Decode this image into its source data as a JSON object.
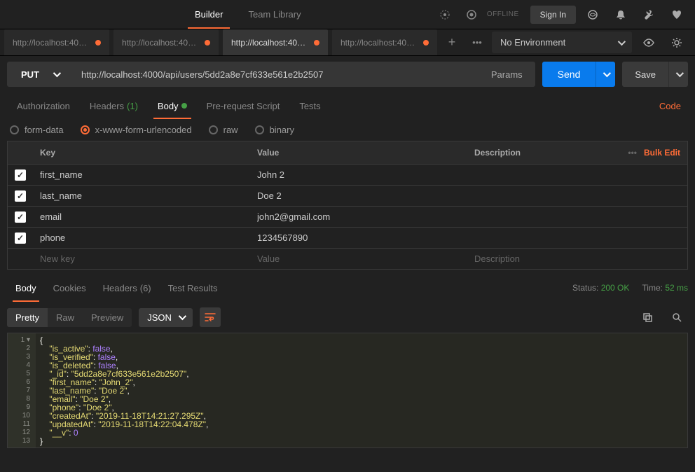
{
  "topbar": {
    "nav": {
      "builder": "Builder",
      "teamLibrary": "Team Library"
    },
    "offline": "OFFLINE",
    "signIn": "Sign In"
  },
  "reqTabs": [
    {
      "label": "http://localhost:4000...",
      "active": false
    },
    {
      "label": "http://localhost:4000...",
      "active": false
    },
    {
      "label": "http://localhost:4000...",
      "active": true
    },
    {
      "label": "http://localhost:4000...",
      "active": false
    }
  ],
  "addTabGlyph": "+",
  "env": {
    "selected": "No Environment"
  },
  "url": {
    "method": "PUT",
    "value": "http://localhost:4000/api/users/5dd2a8e7cf633e561e2b2507",
    "params": "Params",
    "send": "Send",
    "save": "Save"
  },
  "subtabs": {
    "authorization": "Authorization",
    "headers": "Headers",
    "headersCount": "(1)",
    "body": "Body",
    "prerequest": "Pre-request Script",
    "tests": "Tests",
    "code": "Code"
  },
  "bodytypes": {
    "formdata": "form-data",
    "urlencoded": "x-www-form-urlencoded",
    "raw": "raw",
    "binary": "binary"
  },
  "table": {
    "head": {
      "key": "Key",
      "value": "Value",
      "description": "Description",
      "bulkEdit": "Bulk Edit"
    },
    "rows": [
      {
        "key": "first_name",
        "value": "John 2",
        "description": ""
      },
      {
        "key": "last_name",
        "value": "Doe 2",
        "description": ""
      },
      {
        "key": "email",
        "value": "john2@gmail.com",
        "description": ""
      },
      {
        "key": "phone",
        "value": "1234567890",
        "description": ""
      }
    ],
    "placeholder": {
      "key": "New key",
      "value": "Value",
      "description": "Description"
    }
  },
  "respTabs": {
    "body": "Body",
    "cookies": "Cookies",
    "headers": "Headers",
    "headersCount": "(6)",
    "testResults": "Test Results"
  },
  "respStatus": {
    "statusLabel": "Status:",
    "statusValue": "200 OK",
    "timeLabel": "Time:",
    "timeValue": "52 ms"
  },
  "viewer": {
    "pretty": "Pretty",
    "raw": "Raw",
    "preview": "Preview",
    "format": "JSON"
  },
  "responseBody": {
    "is_active": false,
    "is_verified": false,
    "is_deleted": false,
    "_id": "5dd2a8e7cf633e561e2b2507",
    "first_name": "John_2",
    "last_name": "Doe 2",
    "email": "Doe 2",
    "phone": "Doe 2",
    "createdAt": "2019-11-18T14:21:27.295Z",
    "updatedAt": "2019-11-18T14:22:04.478Z",
    "__v": 0
  },
  "gutter": [
    "1",
    "2",
    "3",
    "4",
    "5",
    "6",
    "7",
    "8",
    "9",
    "10",
    "11",
    "12",
    "13"
  ]
}
